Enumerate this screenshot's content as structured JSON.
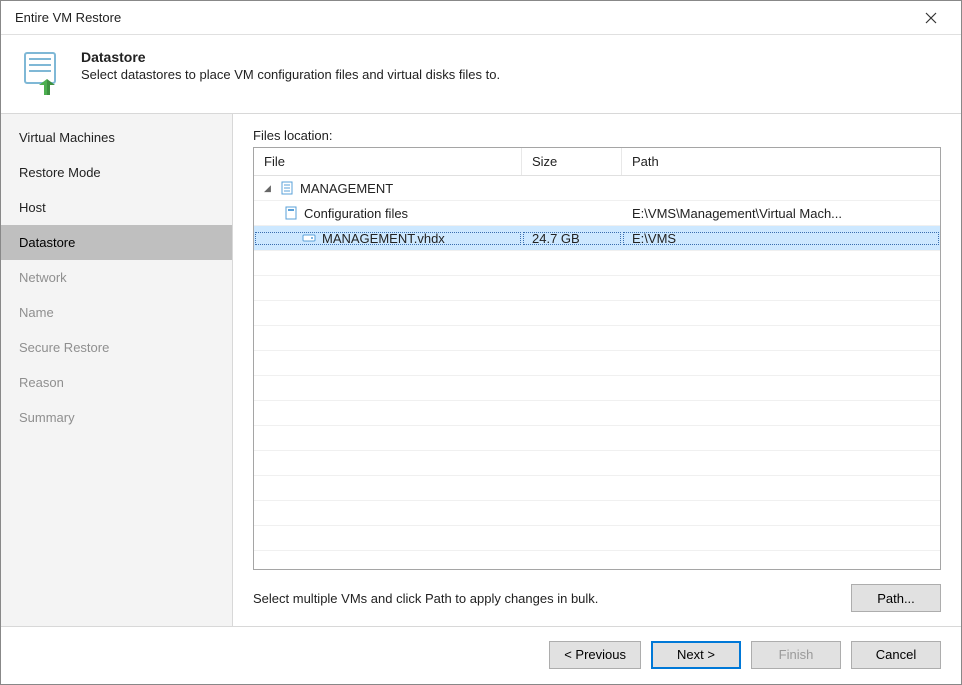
{
  "window": {
    "title": "Entire VM Restore"
  },
  "header": {
    "title": "Datastore",
    "description": "Select datastores to place VM configuration files and virtual disks files to."
  },
  "sidebar": {
    "items": [
      {
        "label": "Virtual Machines",
        "state": "enabled"
      },
      {
        "label": "Restore Mode",
        "state": "enabled"
      },
      {
        "label": "Host",
        "state": "enabled"
      },
      {
        "label": "Datastore",
        "state": "active"
      },
      {
        "label": "Network",
        "state": "disabled"
      },
      {
        "label": "Name",
        "state": "disabled"
      },
      {
        "label": "Secure Restore",
        "state": "disabled"
      },
      {
        "label": "Reason",
        "state": "disabled"
      },
      {
        "label": "Summary",
        "state": "disabled"
      }
    ]
  },
  "main": {
    "section_label": "Files location:",
    "columns": {
      "file": "File",
      "size": "Size",
      "path": "Path"
    },
    "rows": [
      {
        "file": "MANAGEMENT",
        "size": "",
        "path": "",
        "icon": "vm",
        "indent": 0,
        "expanded": true,
        "selected": false
      },
      {
        "file": "Configuration files",
        "size": "",
        "path": "E:\\VMS\\Management\\Virtual Mach...",
        "icon": "config",
        "indent": 1,
        "selected": false
      },
      {
        "file": "MANAGEMENT.vhdx",
        "size": "24.7 GB",
        "path": "E:\\VMS",
        "icon": "disk",
        "indent": 2,
        "selected": true
      }
    ],
    "hint": "Select multiple VMs and click Path to apply changes in bulk.",
    "path_button": "Path..."
  },
  "footer": {
    "previous": "< Previous",
    "next": "Next >",
    "finish": "Finish",
    "cancel": "Cancel"
  }
}
